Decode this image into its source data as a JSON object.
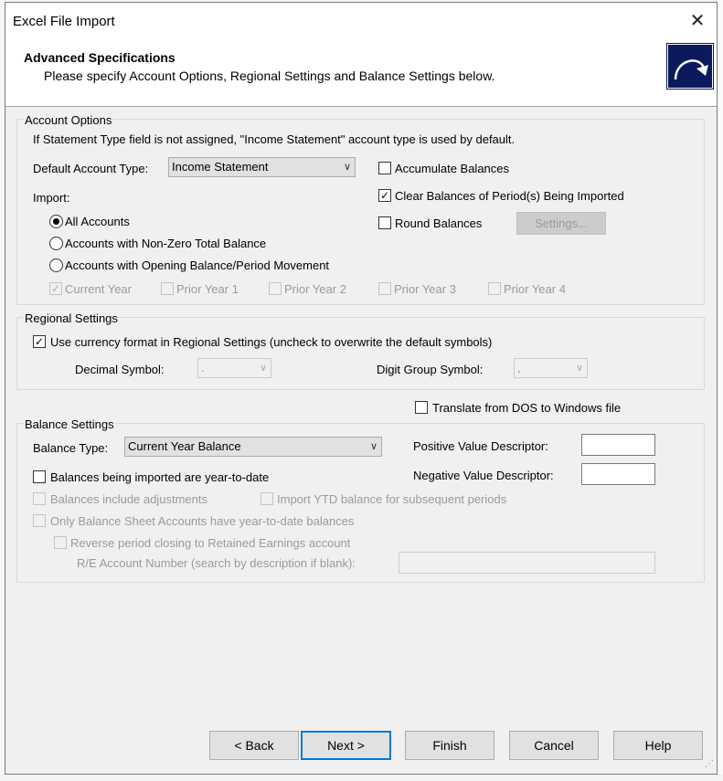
{
  "window": {
    "title": "Excel File Import",
    "close_glyph": "✕"
  },
  "header": {
    "title": "Advanced Specifications",
    "subtitle": "Please specify Account Options, Regional Settings and Balance Settings below."
  },
  "account_options": {
    "group_label": "Account Options",
    "info": "If Statement Type field is not assigned, \"Income Statement\" account type is used by default.",
    "default_type_label": "Default Account Type:",
    "default_type_value": "Income Statement",
    "import_label": "Import:",
    "radios": [
      {
        "label": "All Accounts",
        "selected": true
      },
      {
        "label": "Accounts with Non-Zero Total Balance",
        "selected": false
      },
      {
        "label": "Accounts with Opening Balance/Period Movement",
        "selected": false
      }
    ],
    "accumulate_label": "Accumulate Balances",
    "accumulate_checked": false,
    "clear_label": "Clear Balances of Period(s) Being Imported",
    "clear_checked": true,
    "round_label": "Round Balances",
    "round_checked": false,
    "settings_button": "Settings...",
    "years": [
      {
        "label": "Current Year",
        "checked": true
      },
      {
        "label": "Prior Year 1",
        "checked": false
      },
      {
        "label": "Prior Year 2",
        "checked": false
      },
      {
        "label": "Prior Year 3",
        "checked": false
      },
      {
        "label": "Prior Year 4",
        "checked": false
      }
    ]
  },
  "regional": {
    "group_label": "Regional Settings",
    "use_currency_label": "Use currency format in Regional Settings (uncheck to overwrite the default symbols)",
    "use_currency_checked": true,
    "decimal_label": "Decimal Symbol:",
    "decimal_value": ".",
    "digit_group_label": "Digit Group Symbol:",
    "digit_group_value": ","
  },
  "translate": {
    "label": "Translate from DOS to Windows file",
    "checked": false
  },
  "balance": {
    "group_label": "Balance Settings",
    "type_label": "Balance Type:",
    "type_value": "Current Year Balance",
    "positive_label": "Positive Value Descriptor:",
    "positive_value": "",
    "negative_label": "Negative Value Descriptor:",
    "negative_value": "",
    "ytd_label": "Balances being imported are year-to-date",
    "ytd_checked": false,
    "adjustments_label": "Balances include adjustments",
    "import_ytd_label": "Import YTD balance for subsequent periods",
    "only_bs_label": "Only Balance Sheet Accounts have year-to-date balances",
    "reverse_label": "Reverse period closing to Retained Earnings account",
    "re_account_label": "R/E Account Number (search by description if blank):",
    "re_account_value": ""
  },
  "buttons": {
    "back": "< Back",
    "next": "Next >",
    "finish": "Finish",
    "cancel": "Cancel",
    "help": "Help"
  },
  "glyphs": {
    "check": "✓",
    "dropdown": "⌄",
    "chevron": "∨",
    "grip": "⋰"
  },
  "colors": {
    "logo_bg": "#0a1a5c",
    "default_button_border": "#0078d7",
    "dialog_bg": "#f0f0f0"
  }
}
